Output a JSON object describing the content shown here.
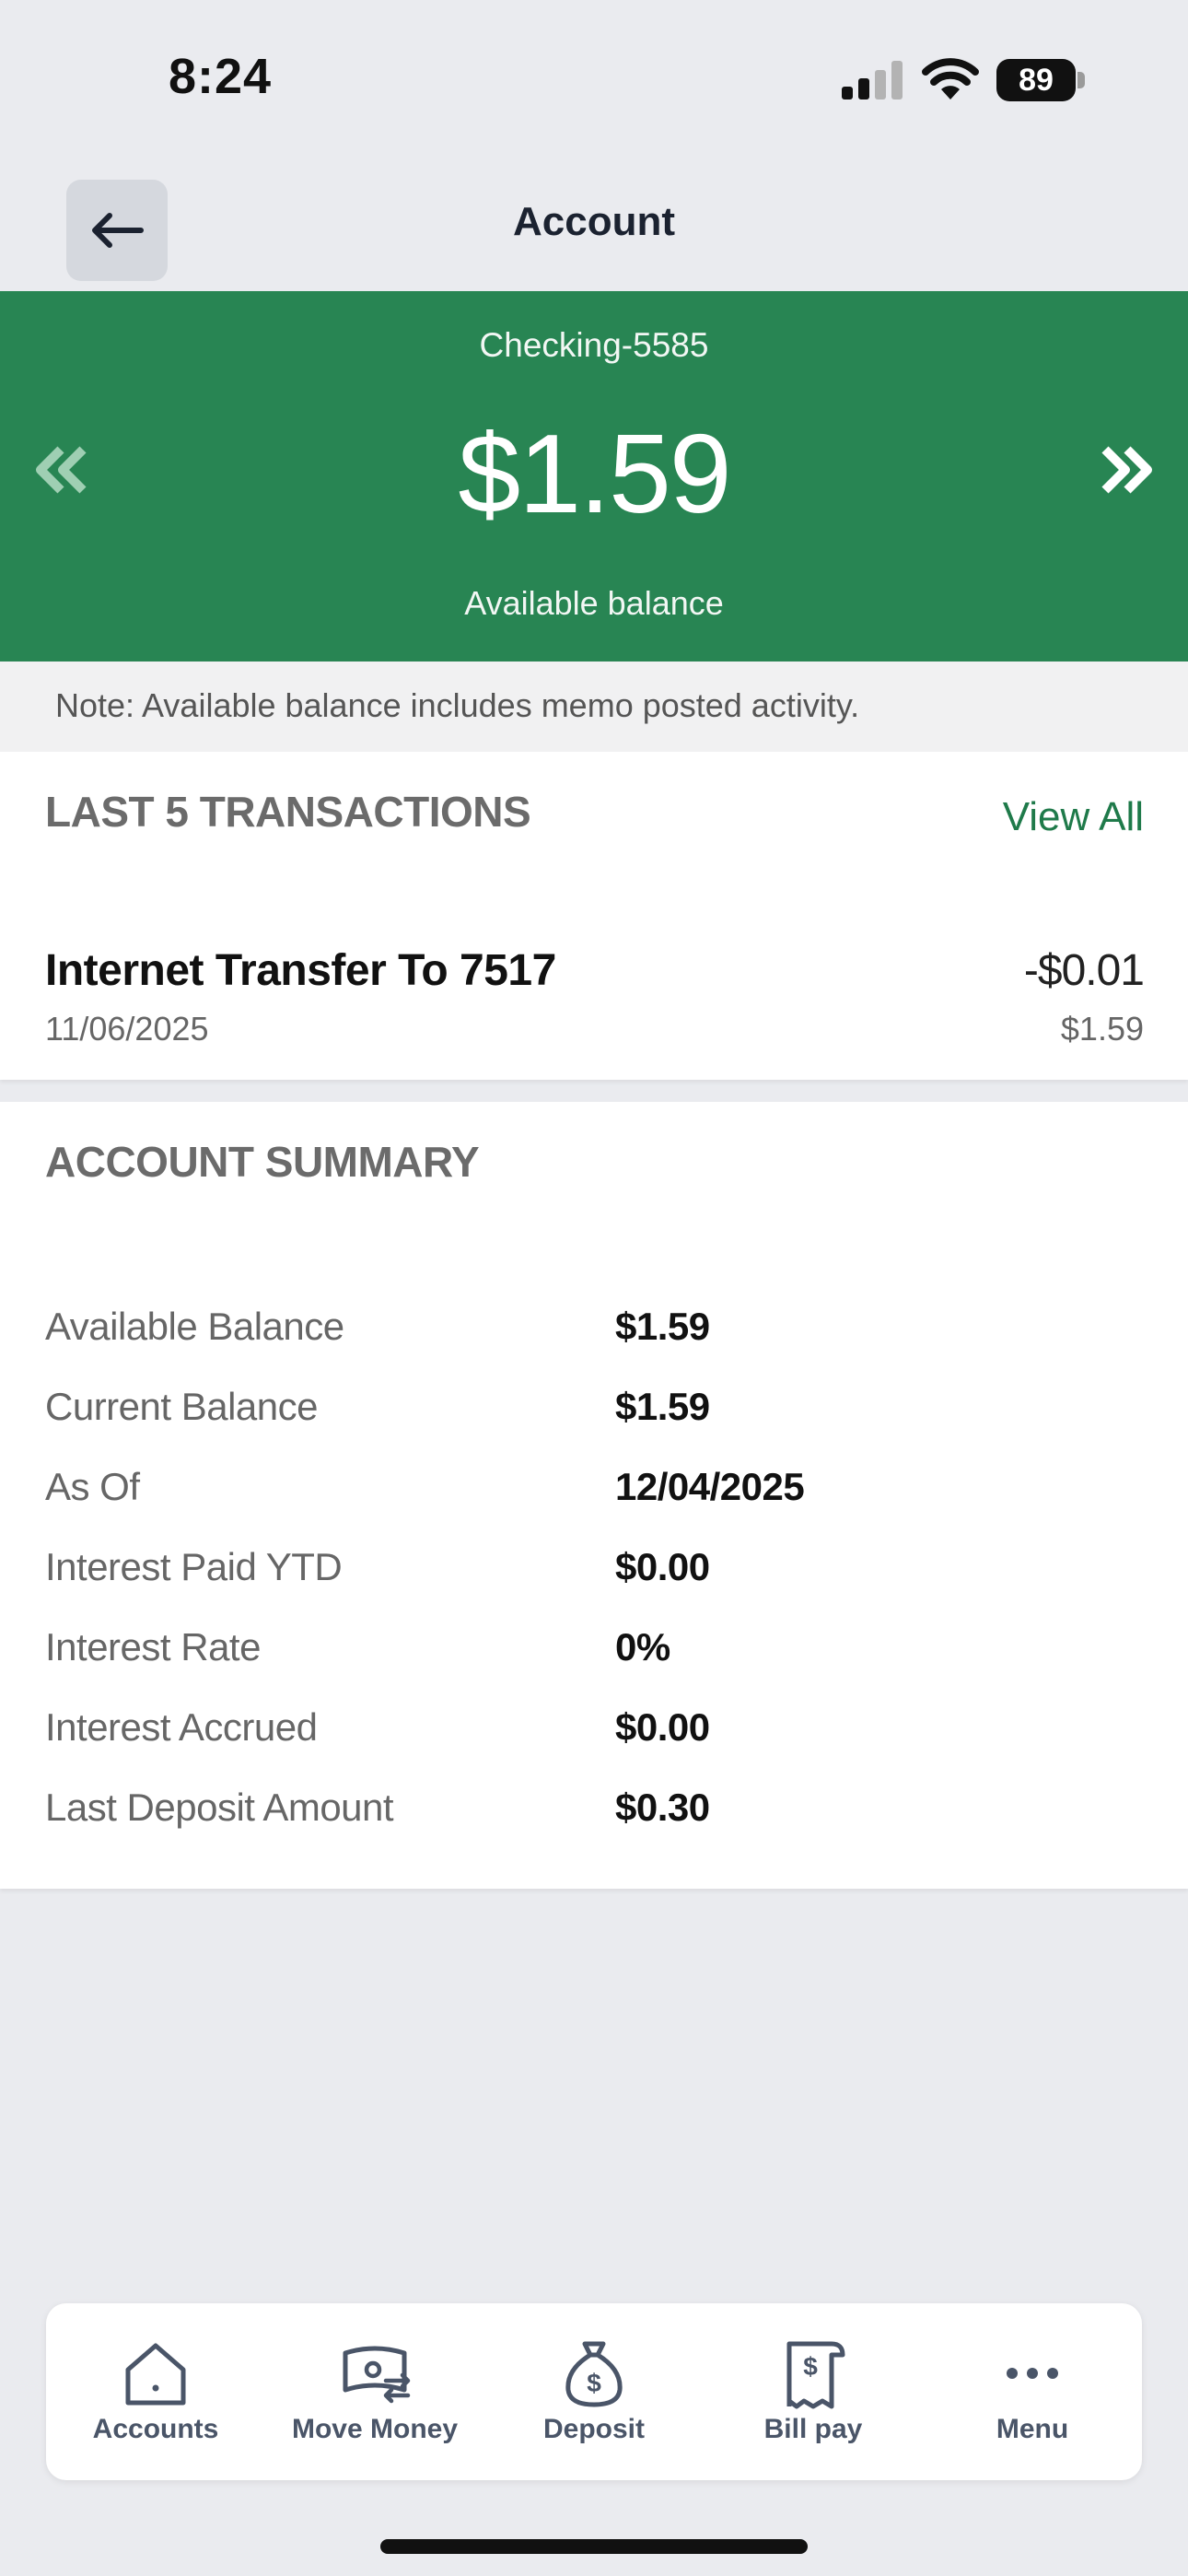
{
  "status_bar": {
    "time": "8:24",
    "battery": "89"
  },
  "header": {
    "title": "Account"
  },
  "banner": {
    "account_name": "Checking-5585",
    "balance": "$1.59",
    "caption": "Available balance",
    "background_color": "#288553"
  },
  "note": "Note: Available balance includes memo posted activity.",
  "transactions": {
    "title": "LAST 5 TRANSACTIONS",
    "view_all": "View All",
    "items": [
      {
        "description": "Internet Transfer To 7517",
        "date": "11/06/2025",
        "amount": "-$0.01",
        "balance": "$1.59"
      }
    ]
  },
  "summary": {
    "title": "ACCOUNT SUMMARY",
    "rows": [
      {
        "label": "Available Balance",
        "value": "$1.59"
      },
      {
        "label": "Current Balance",
        "value": "$1.59"
      },
      {
        "label": "As Of",
        "value": "12/04/2025"
      },
      {
        "label": "Interest Paid YTD",
        "value": "$0.00"
      },
      {
        "label": "Interest Rate",
        "value": "0%"
      },
      {
        "label": "Interest Accrued",
        "value": "$0.00"
      },
      {
        "label": "Last Deposit Amount",
        "value": "$0.30"
      }
    ]
  },
  "nav": {
    "items": [
      {
        "label": "Accounts",
        "icon": "home-icon"
      },
      {
        "label": "Move Money",
        "icon": "money-transfer-icon"
      },
      {
        "label": "Deposit",
        "icon": "money-bag-icon"
      },
      {
        "label": "Bill pay",
        "icon": "receipt-icon"
      },
      {
        "label": "Menu",
        "icon": "more-icon"
      }
    ]
  }
}
